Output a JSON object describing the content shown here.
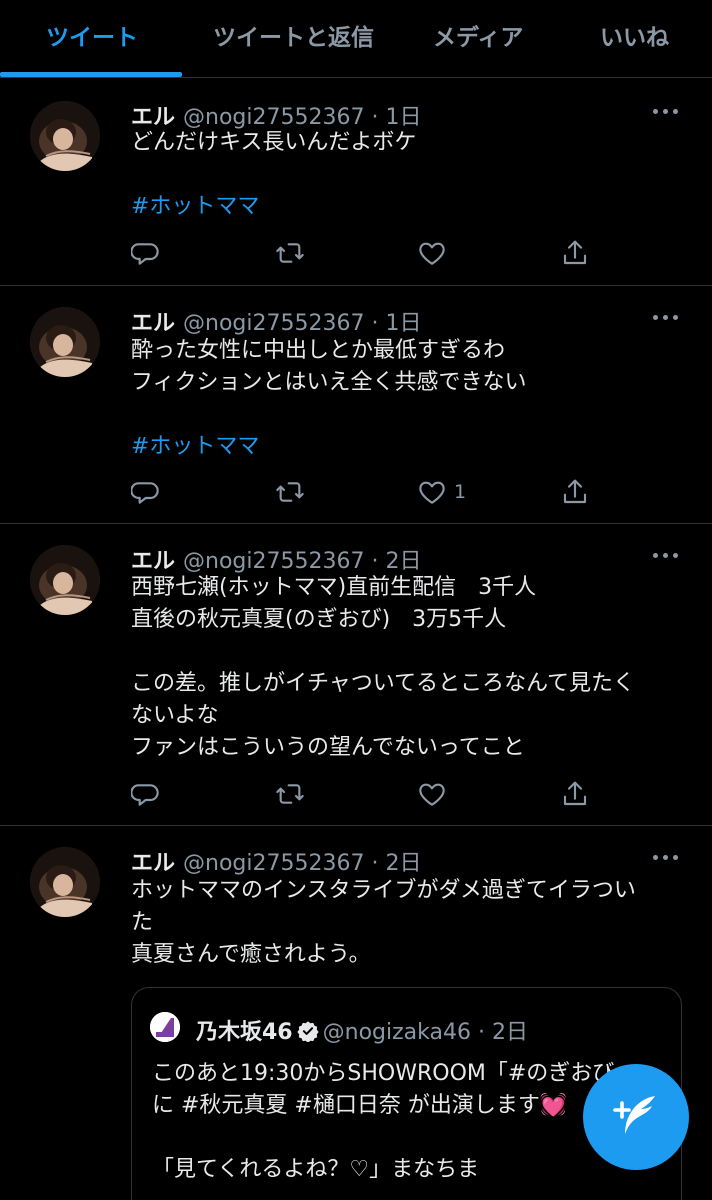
{
  "tabs": [
    {
      "label": "ツイート",
      "active": true
    },
    {
      "label": "ツイートと返信",
      "active": false
    },
    {
      "label": "メディア",
      "active": false
    },
    {
      "label": "いいね",
      "active": false
    }
  ],
  "tweets": [
    {
      "name": "エル",
      "handle": "@nogi27552367 · 1日",
      "lines": [
        "どんだけキス長いんだよボケ"
      ],
      "hashtag": "#ホットママ",
      "like_count": ""
    },
    {
      "name": "エル",
      "handle": "@nogi27552367 · 1日",
      "lines": [
        "酔った女性に中出しとか最低すぎるわ",
        "フィクションとはいえ全く共感できない"
      ],
      "hashtag": "#ホットママ",
      "like_count": "1"
    },
    {
      "name": "エル",
      "handle": "@nogi27552367 · 2日",
      "lines": [
        "西野七瀬(ホットママ)直前生配信　3千人",
        "直後の秋元真夏(のぎおび)　3万5千人",
        "",
        "この差。推しがイチャついてるところなんて見たく",
        "ないよな",
        "ファンはこういうの望んでないってこと"
      ],
      "hashtag": "",
      "like_count": ""
    },
    {
      "name": "エル",
      "handle": "@nogi27552367 · 2日",
      "lines": [
        "ホットママのインスタライブがダメ過ぎてイラつい",
        "た",
        "真夏さんで癒されよう。"
      ],
      "hashtag": "",
      "like_count": ""
    }
  ],
  "quote": {
    "name": "乃木坂46",
    "handle": "@nogizaka46 · 2日",
    "line1": "このあと19:30からSHOWROOM「#のぎおび」",
    "line2": "に #秋元真夏 #樋口日奈 が出演します",
    "line2_emoji": "💓",
    "line3": "",
    "line4": "「見てくれるよね？♡」まなちま"
  },
  "icons": {
    "reply": "reply-icon",
    "retweet": "retweet-icon",
    "like": "heart-icon",
    "share": "share-icon",
    "more": "more-icon",
    "compose": "compose-tweet-icon",
    "verified": "verified-badge-icon"
  },
  "colors": {
    "background": "#000000",
    "accent": "#1d9bf0",
    "muted": "#8b98a5",
    "text": "#e7e9ea",
    "divider": "#2f3336"
  }
}
